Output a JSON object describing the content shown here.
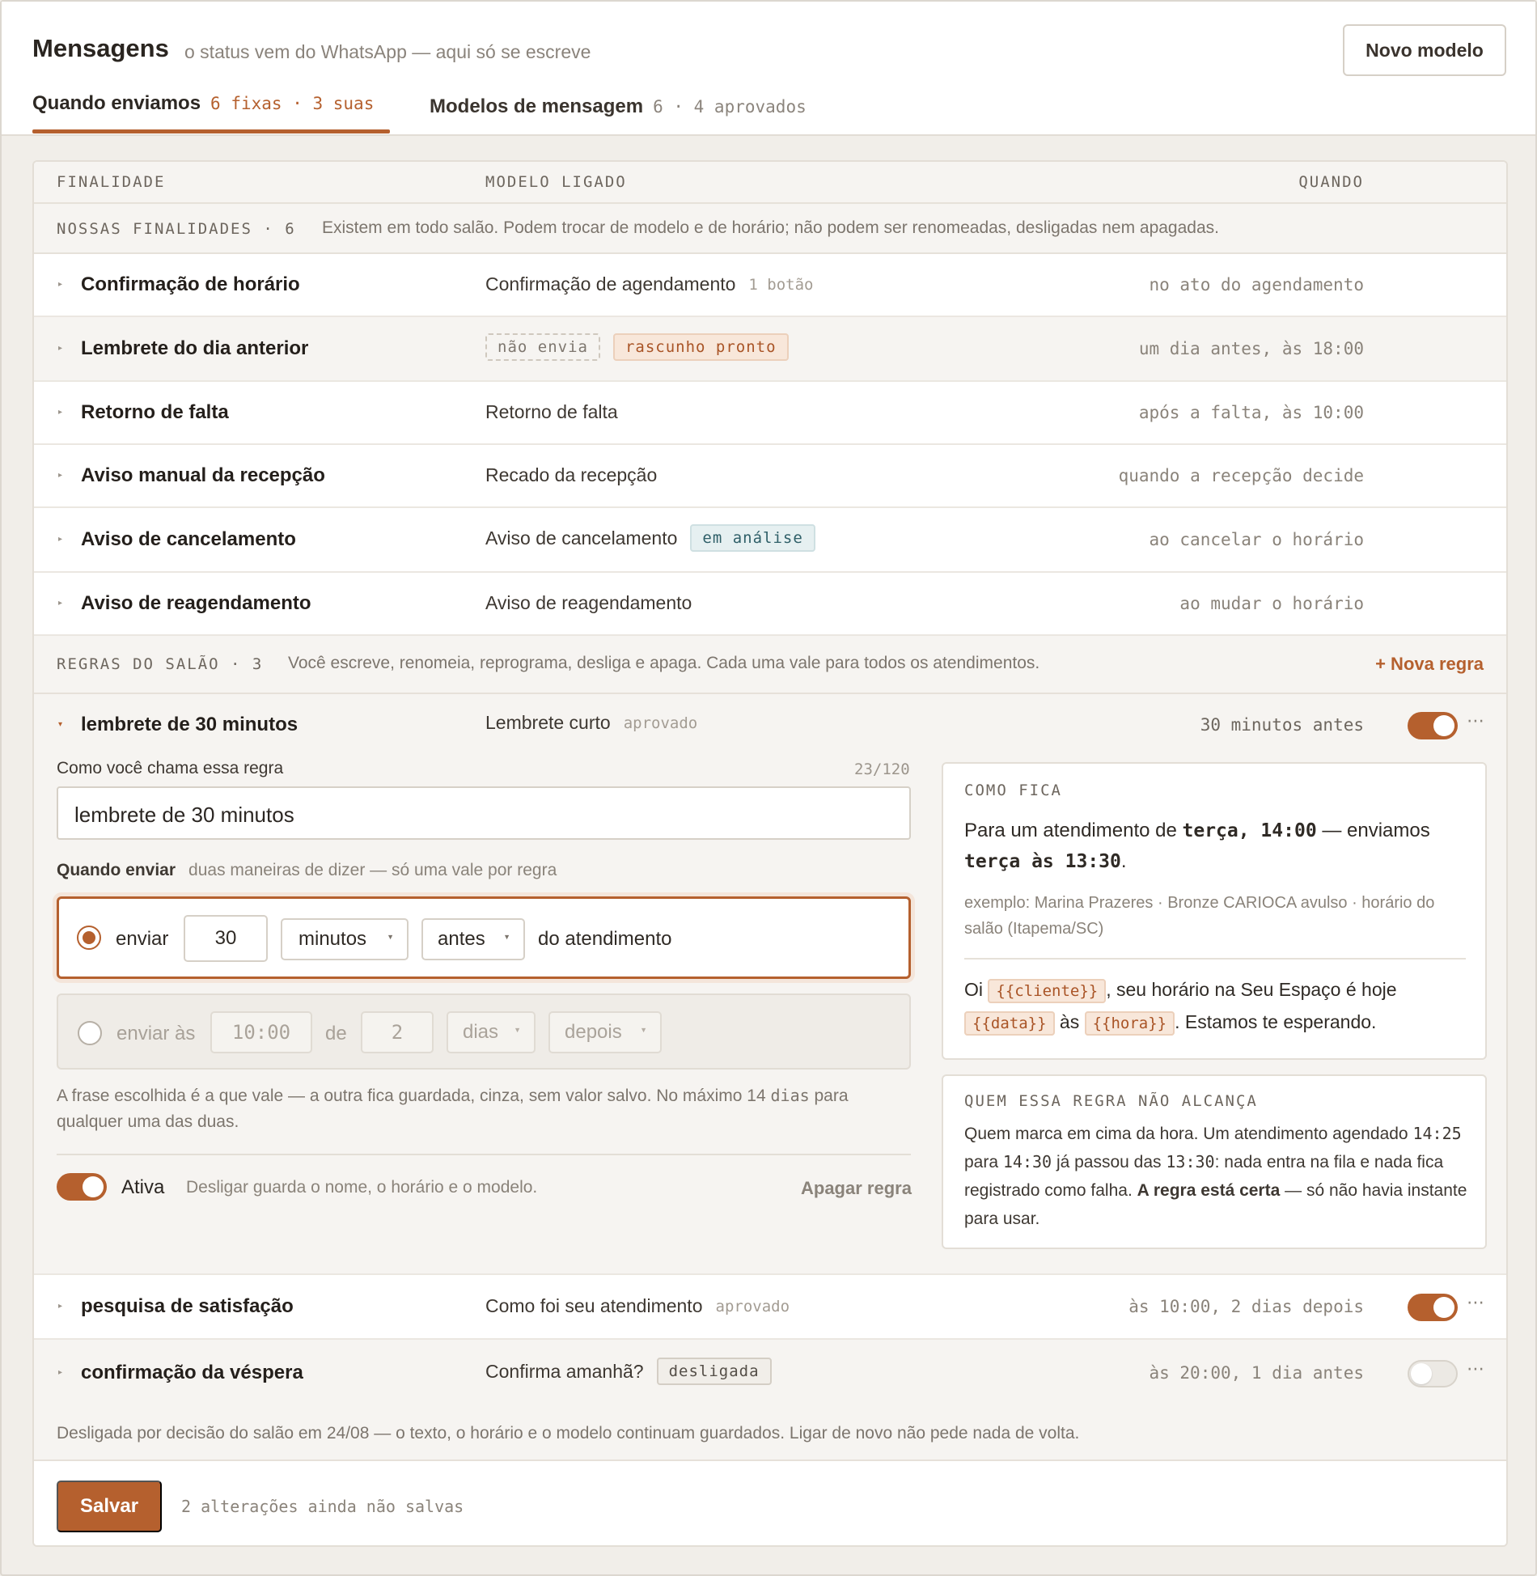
{
  "header": {
    "title": "Mensagens",
    "subtitle": "o status vem do WhatsApp — aqui só se escreve",
    "new_button": "Novo modelo"
  },
  "tabs": [
    {
      "label": "Quando enviamos",
      "count": "6 fixas · 3 suas",
      "active": true
    },
    {
      "label": "Modelos de mensagem",
      "count": "6 · 4 aprovados",
      "active": false
    }
  ],
  "columns": {
    "purpose": "FINALIDADE",
    "model": "MODELO LIGADO",
    "when": "QUANDO"
  },
  "fixed_section": {
    "label": "NOSSAS FINALIDADES · 6",
    "description": "Existem em todo salão. Podem trocar de modelo e de horário; não podem ser renomeadas, desligadas nem apagadas.",
    "rows": [
      {
        "name": "Confirmação de horário",
        "model": "Confirmação de agendamento",
        "model_meta": "1 botão",
        "when": "no ato do agendamento"
      },
      {
        "name": "Lembrete do dia anterior",
        "tag_dashed": "não envia",
        "tag_draft": "rascunho pronto",
        "when": "um dia antes, às 18:00"
      },
      {
        "name": "Retorno de falta",
        "model": "Retorno de falta",
        "when": "após a falta, às 10:00"
      },
      {
        "name": "Aviso manual da recepção",
        "model": "Recado da recepção",
        "when": "quando a recepção decide"
      },
      {
        "name": "Aviso de cancelamento",
        "model": "Aviso de cancelamento",
        "tag_review": "em análise",
        "when": "ao cancelar o horário"
      },
      {
        "name": "Aviso de reagendamento",
        "model": "Aviso de reagendamento",
        "when": "ao mudar o horário"
      }
    ]
  },
  "rules_section": {
    "label": "REGRAS DO SALÃO · 3",
    "description": "Você escreve, renomeia, reprograma, desliga e apaga. Cada uma vale para todos os atendimentos.",
    "new_rule": "+ Nova regra",
    "rules": [
      {
        "name": "lembrete de 30 minutos",
        "model": "Lembrete curto",
        "status": "aprovado",
        "when": "30 minutos antes",
        "enabled": true
      },
      {
        "name": "pesquisa de satisfação",
        "model": "Como foi seu atendimento",
        "status": "aprovado",
        "when": "às 10:00, 2 dias depois",
        "enabled": true
      },
      {
        "name": "confirmação da véspera",
        "model": "Confirma amanhã?",
        "status": "desligada",
        "when": "às 20:00, 1 dia antes",
        "enabled": false
      }
    ],
    "off_note": "Desligada por decisão do salão em 24/08 — o texto, o horário e o modelo continuam guardados. Ligar de novo não pede nada de volta."
  },
  "editor": {
    "name_label": "Como você chama essa regra",
    "name_counter": "23/120",
    "name_value": "lembrete de 30 minutos",
    "when_label": "Quando enviar",
    "when_hint": "duas maneiras de dizer — só uma vale por regra",
    "option_relative": {
      "prefix": "enviar",
      "amount": "30",
      "unit": "minutos",
      "direction": "antes",
      "suffix": "do atendimento"
    },
    "option_absolute": {
      "prefix": "enviar às",
      "time": "10:00",
      "of": "de",
      "amount": "2",
      "unit": "dias",
      "direction": "depois"
    },
    "note_part1": "A frase escolhida é a que vale — a outra fica guardada, cinza, sem valor salvo. No máximo 14",
    "note_unit": "dias",
    "note_part2": "para qualquer uma das duas.",
    "active_label": "Ativa",
    "active_hint": "Desligar guarda o nome, o horário e o modelo.",
    "delete_label": "Apagar regra"
  },
  "preview": {
    "title": "COMO FICA",
    "line_a": "Para um atendimento de",
    "when_a": "terça, 14:00",
    "line_b": "— enviamos",
    "when_b": "terça às 13:30",
    "dot": ".",
    "example": "exemplo: Marina Prazeres · Bronze CARIOCA avulso · horário do salão (Itapema/SC)",
    "msg_start": "Oi",
    "var_client": "{{cliente}}",
    "msg_mid": ", seu horário na Seu Espaço é hoje",
    "var_date": "{{data}}",
    "msg_as": "às",
    "var_hour": "{{hora}}",
    "msg_end": ". Estamos te esperando."
  },
  "not_reached": {
    "title": "QUEM ESSA REGRA NÃO ALCANÇA",
    "t1": "Quem marca em cima da hora. Um atendimento agendado",
    "time1": "14:25",
    "t2": "para",
    "time2": "14:30",
    "t3": "já passou das",
    "time3": "13:30",
    "t4": ": nada entra na fila e nada fica registrado como falha.",
    "bold": "A regra está certa",
    "t5": "— só não havia instante para usar."
  },
  "footer": {
    "save": "Salvar",
    "unsaved": "2 alterações ainda não salvas"
  },
  "colors": {
    "accent": "#b5602e",
    "review": "#2f5f68"
  }
}
